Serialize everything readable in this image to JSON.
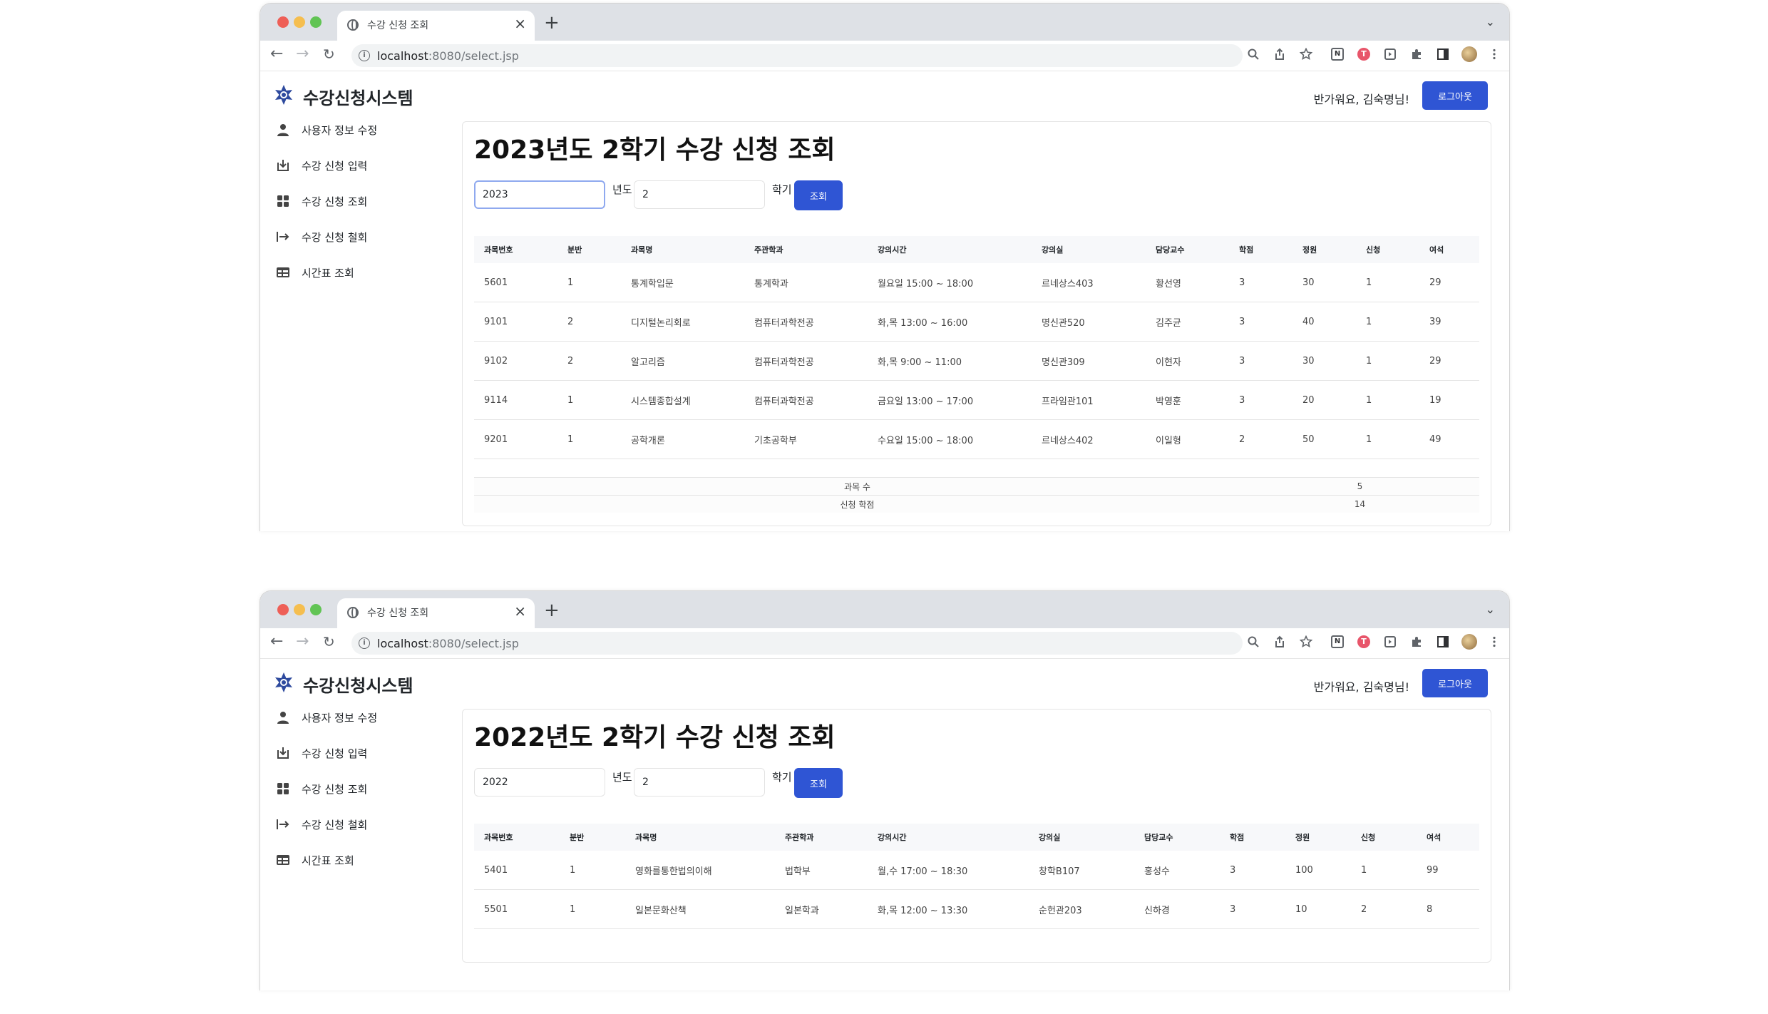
{
  "browser": {
    "tab_title": "수강 신청 조회",
    "tab_close": "×",
    "new_tab": "+",
    "tab_menu": "⌄",
    "back": "←",
    "forward": "→",
    "reload": "↻",
    "url_host": "localhost",
    "url_path": ":8080/select.jsp",
    "info": "i"
  },
  "app": {
    "brand": "수강신청시스템",
    "greeting": "반가워요, 김숙명님!",
    "logout": "로그아웃"
  },
  "sidebar": {
    "items": [
      {
        "label": "사용자 정보 수정",
        "icon": "person-icon"
      },
      {
        "label": "수강 신청 입력",
        "icon": "download-icon"
      },
      {
        "label": "수강 신청 조회",
        "icon": "grid-icon"
      },
      {
        "label": "수강 신청 철회",
        "icon": "exit-arrow-icon"
      },
      {
        "label": "시간표 조회",
        "icon": "table-icon"
      }
    ]
  },
  "form_labels": {
    "year": "년도",
    "semester": "학기",
    "submit": "조회"
  },
  "table_headers": [
    "과목번호",
    "분반",
    "과목명",
    "주관학과",
    "강의시간",
    "강의실",
    "담당교수",
    "학점",
    "정원",
    "신청",
    "여석"
  ],
  "screens": [
    {
      "title": "2023년도 2학기 수강 신청 조회",
      "year": "2023",
      "semester": "2",
      "rows": [
        [
          "5601",
          "1",
          "통계학입문",
          "통계학과",
          "월요일 15:00 ~ 18:00",
          "르네상스403",
          "황선영",
          "3",
          "30",
          "1",
          "29"
        ],
        [
          "9101",
          "2",
          "디지털논리회로",
          "컴퓨터과학전공",
          "화,목 13:00 ~ 16:00",
          "명신관520",
          "김주균",
          "3",
          "40",
          "1",
          "39"
        ],
        [
          "9102",
          "2",
          "알고리즘",
          "컴퓨터과학전공",
          "화,목 9:00 ~ 11:00",
          "명신관309",
          "이현자",
          "3",
          "30",
          "1",
          "29"
        ],
        [
          "9114",
          "1",
          "시스템종합설계",
          "컴퓨터과학전공",
          "금요일 13:00 ~ 17:00",
          "프라임관101",
          "박영훈",
          "3",
          "20",
          "1",
          "19"
        ],
        [
          "9201",
          "1",
          "공학개론",
          "기초공학부",
          "수요일 15:00 ~ 18:00",
          "르네상스402",
          "이일형",
          "2",
          "50",
          "1",
          "49"
        ]
      ],
      "summary": [
        {
          "label": "과목 수",
          "value": "5"
        },
        {
          "label": "신청 학점",
          "value": "14"
        }
      ]
    },
    {
      "title": "2022년도 2학기 수강 신청 조회",
      "year": "2022",
      "semester": "2",
      "rows": [
        [
          "5401",
          "1",
          "영화를통한법의이해",
          "법학부",
          "월,수 17:00 ~ 18:30",
          "창학B107",
          "홍성수",
          "3",
          "100",
          "1",
          "99"
        ],
        [
          "5501",
          "1",
          "일본문화산책",
          "일본학과",
          "화,목 12:00 ~ 13:30",
          "순헌관203",
          "신하경",
          "3",
          "10",
          "2",
          "8"
        ]
      ],
      "summary": []
    }
  ],
  "colors": {
    "primary": "#2f55d4",
    "logo": "#2e4a9e",
    "tabstrip": "#dee1e6"
  }
}
